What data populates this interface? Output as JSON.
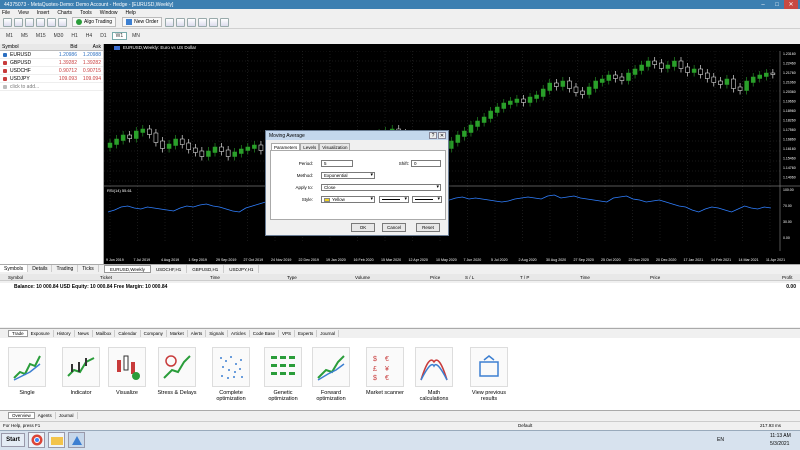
{
  "window": {
    "title": "44375073 - MetaQuotes-Demo: Demo Account - Hedge - [EURUSD,Weekly]"
  },
  "menu": [
    "File",
    "View",
    "Insert",
    "Charts",
    "Tools",
    "Window",
    "Help"
  ],
  "toolbar": {
    "algo_trading": "Algo Trading",
    "new_order": "New Order"
  },
  "timeframes": [
    "M1",
    "M5",
    "M15",
    "M30",
    "H1",
    "H4",
    "D1",
    "W1",
    "MN"
  ],
  "market_watch": {
    "headers": {
      "symbol": "Symbol",
      "bid": "Bid",
      "ask": "Ask"
    },
    "rows": [
      {
        "symbol": "EURUSD",
        "bid": "1.20986",
        "ask": "1.20988",
        "color": "#2b6fc1"
      },
      {
        "symbol": "GBPUSD",
        "bid": "1.39282",
        "ask": "1.39282",
        "color": "#c83b3b"
      },
      {
        "symbol": "USDCHF",
        "bid": "0.90712",
        "ask": "0.90715",
        "color": "#c83b3b"
      },
      {
        "symbol": "USDJPY",
        "bid": "109.093",
        "ask": "109.094",
        "color": "#c83b3b"
      }
    ],
    "add_hint": "click to add...",
    "tabs": [
      "Symbols",
      "Details",
      "Trading",
      "Ticks"
    ]
  },
  "chart": {
    "header": "EURUSD,Weekly: Euro vs US Dollar",
    "rsi_label": "RSI(14) 55.61",
    "price_ticks": [
      "1.23160",
      "1.22460",
      "1.21760",
      "1.21060",
      "1.20360",
      "1.19660",
      "1.18960",
      "1.18260",
      "1.17560",
      "1.16860",
      "1.16160",
      "1.15460",
      "1.14760",
      "1.14060",
      "1.13360",
      "1.12660",
      "1.11960",
      "1.11260",
      "1.10560",
      "1.09860",
      "1.09160",
      "1.08460",
      "1.07760",
      "1.07060",
      "1.06360"
    ],
    "rsi_ticks": [
      "100.00",
      "70.00",
      "30.00",
      "0.00"
    ],
    "date_ticks": [
      "9 Jun 2019",
      "7 Jul 2019",
      "4 Aug 2019",
      "1 Sep 2019",
      "29 Sep 2019",
      "27 Oct 2019",
      "24 Nov 2019",
      "22 Dec 2019",
      "19 Jan 2020",
      "16 Feb 2020",
      "15 Mar 2020",
      "12 Apr 2020",
      "10 May 2020",
      "7 Jun 2020",
      "5 Jul 2020",
      "2 Aug 2020",
      "30 Aug 2020",
      "27 Sep 2020",
      "25 Oct 2020",
      "22 Nov 2020",
      "20 Dec 2020",
      "17 Jan 2021",
      "14 Feb 2021",
      "14 Mar 2021",
      "11 Apr 2021"
    ],
    "tabs": [
      "EURUSD,Weekly",
      "USDCHF,H1",
      "GBPUSD,H1",
      "USDJPY,H1"
    ]
  },
  "dialog": {
    "title": "Moving Average",
    "tabs": [
      "Parameters",
      "Levels",
      "Visualization"
    ],
    "period_label": "Period:",
    "period_value": "5",
    "shift_label": "Shift:",
    "shift_value": "0",
    "method_label": "Method:",
    "method_value": "Exponential",
    "apply_label": "Apply to:",
    "apply_value": "Close",
    "style_label": "Style:",
    "style_value": "Yellow",
    "ok": "OK",
    "cancel": "Cancel",
    "reset": "Reset"
  },
  "terminal": {
    "headers": [
      "Symbol",
      "Ticket",
      "Time",
      "Type",
      "Volume",
      "Price",
      "S / L",
      "T / P",
      "Time",
      "Price",
      "Profit"
    ],
    "balance": "Balance: 10 000.84 USD  Equity: 10 000.84  Free Margin: 10 000.84",
    "profit_value": "0.00",
    "tabs": [
      "Trade",
      "Exposure",
      "History",
      "News",
      "Mailbox",
      "Calendar",
      "Company",
      "Market",
      "Alerts",
      "Signals",
      "Articles",
      "Code Base",
      "VPS",
      "Experts",
      "Journal"
    ]
  },
  "tester": {
    "cards": [
      "Single",
      "Indicator",
      "Visualize",
      "Stress & Delays",
      "Complete optimization",
      "Genetic optimization",
      "Forward optimization",
      "Market scanner",
      "Math calculations",
      "View previous results"
    ],
    "tabs": [
      "Overview",
      "Agents",
      "Journal"
    ]
  },
  "status": {
    "help": "For Help, press F1",
    "profile": "Default",
    "ping": "217.93 ms"
  },
  "taskbar": {
    "start": "Start",
    "lang": "EN",
    "time": "11:13 AM",
    "date": "5/3/2021"
  }
}
